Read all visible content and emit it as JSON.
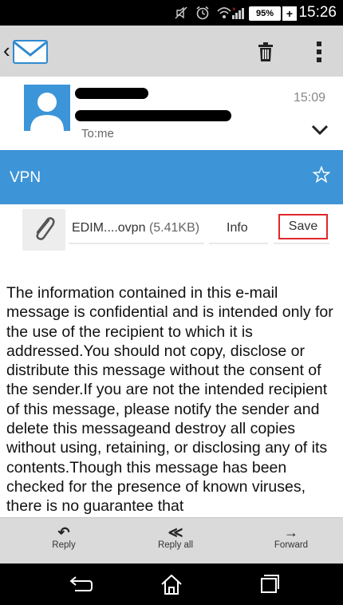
{
  "status_bar": {
    "battery": "95%",
    "battery_plus": "+",
    "time": "15:26"
  },
  "message": {
    "to": "To:me",
    "time": "15:09",
    "subject": "VPN"
  },
  "attachment": {
    "filename": "EDIM....ovpn",
    "size": "(5.41KB)",
    "info_label": "Info",
    "save_label": "Save"
  },
  "body": "The information contained in this e-mail message is confidential and is intended only for the use of the recipient to which it is addressed.You should not copy, disclose or distribute this message without the consent of the sender.If you are not the intended recipient of this message, please notify the sender and delete this messageand destroy all copies without using, retaining, or disclosing any of its contents.Though this message has been checked for the presence of known viruses, there is no guarantee that",
  "reply_bar": {
    "reply_label": "Reply",
    "reply_all_label": "Reply all",
    "forward_label": "Forward"
  },
  "icons": [
    "mute-icon",
    "alarm-icon",
    "wifi-icon",
    "signal-icon",
    "back-icon",
    "mail-app-icon",
    "trash-icon",
    "overflow-menu-icon",
    "avatar",
    "chevron-down-icon",
    "star-icon",
    "paperclip-icon",
    "reply-icon",
    "reply-all-icon",
    "forward-icon",
    "nav-back-icon",
    "home-icon",
    "recents-icon"
  ],
  "colors": {
    "subject_bar": "#3d94d6",
    "save_highlight": "#e0262b",
    "action_bar": "#d7d7d7"
  }
}
